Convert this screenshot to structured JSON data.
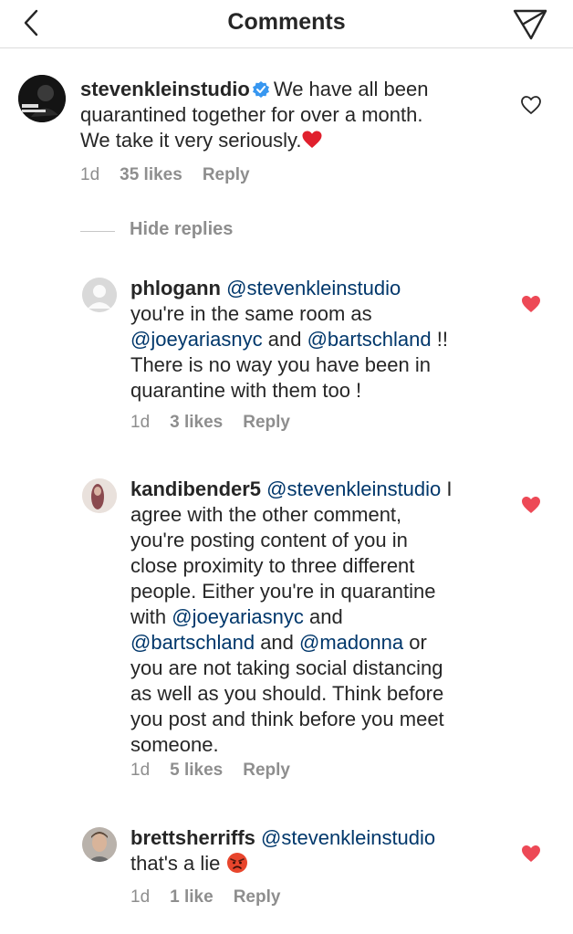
{
  "header": {
    "title": "Comments"
  },
  "colors": {
    "heart_red": "#ed4956",
    "mention": "#00376b",
    "meta_gray": "#8e8e8e",
    "verified_blue": "#3897f0"
  },
  "comments": [
    {
      "username": "stevenkleinstudio",
      "verified": true,
      "lines": [
        "We have all been",
        "quarantined together for over a month.",
        "We take it very seriously."
      ],
      "emoji": "red-heart",
      "time": "1d",
      "likes": "35 likes",
      "reply": "Reply",
      "liked": false
    }
  ],
  "hide_replies": {
    "label": "Hide replies"
  },
  "replies": [
    {
      "username": "phlogann",
      "mention1": "@stevenkleinstudio",
      "l2": "you're in the same room as",
      "m2a": "@joeyariasnyc",
      "and": " and ",
      "m2b": "@bartschland",
      "bang": " !!",
      "l4": "There is no way you have been in",
      "l5": "quarantine with them too !",
      "time": "1d",
      "likes": "3 likes",
      "reply": "Reply",
      "liked": true
    },
    {
      "username": "kandibender5",
      "mention1": "@stevenkleinstudio",
      "i": " I",
      "l2": "agree with the other comment,",
      "l3": "you're posting content of you in",
      "l4": "close proximity to three different",
      "l5": "people. Either you're in quarantine",
      "l6a": "with ",
      "m6": "@joeyariasnyc",
      "l6b": " and",
      "m7a": "@bartschland",
      "l7and": " and ",
      "m7b": "@madonna",
      "l7or": " or",
      "l8": "you are not taking social distancing",
      "l9": "as well as you should. Think before",
      "l10": "you post and think before you meet",
      "l11": "someone.",
      "time": "1d",
      "likes": "5 likes",
      "reply": "Reply",
      "liked": true
    },
    {
      "username": "brettsherriffs",
      "mention1": "@stevenkleinstudio",
      "l2": "that's a lie",
      "emoji": "angry-face",
      "time": "1d",
      "likes": "1 like",
      "reply": "Reply",
      "liked": true
    }
  ]
}
